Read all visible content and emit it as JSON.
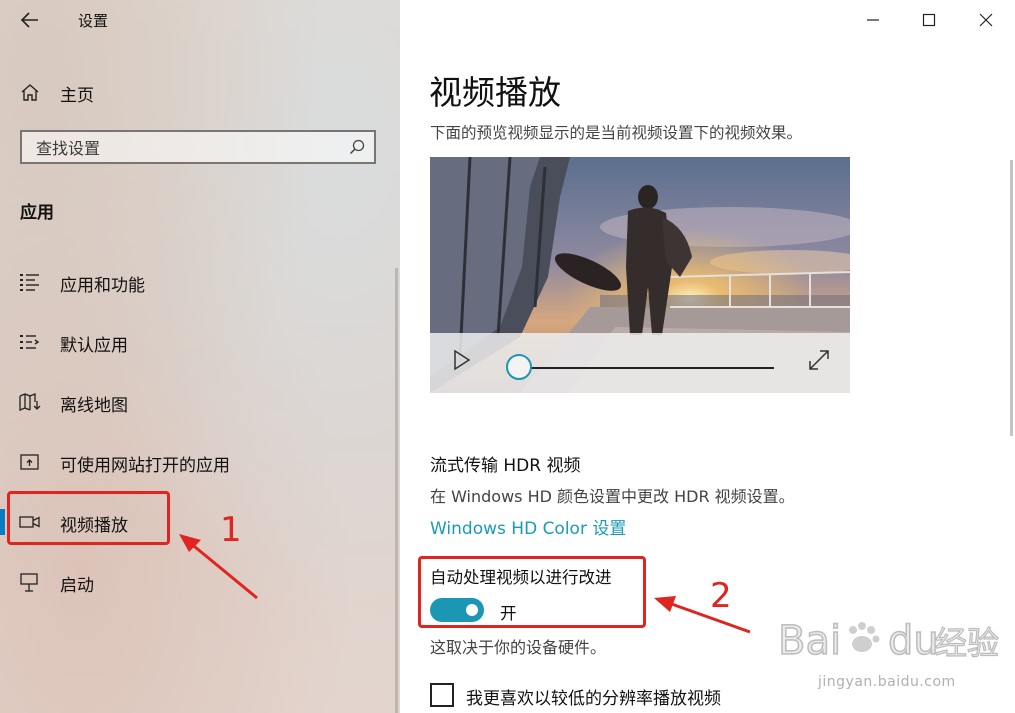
{
  "window": {
    "title": "设置"
  },
  "sidebar": {
    "home_label": "主页",
    "search": {
      "placeholder": "查找设置"
    },
    "section_heading": "应用",
    "items": [
      {
        "label": "应用和功能",
        "icon": "list-icon"
      },
      {
        "label": "默认应用",
        "icon": "default-apps-icon"
      },
      {
        "label": "离线地图",
        "icon": "map-download-icon"
      },
      {
        "label": "可使用网站打开的应用",
        "icon": "open-in-icon"
      },
      {
        "label": "视频播放",
        "icon": "video-camera-icon",
        "selected": true
      },
      {
        "label": "启动",
        "icon": "startup-icon"
      }
    ]
  },
  "main": {
    "page_title": "视频播放",
    "preview_desc": "下面的预览视频显示的是当前视频设置下的视频效果。",
    "video": {
      "progress": 0
    },
    "hdr": {
      "title": "流式传输 HDR 视频",
      "desc": "在 Windows HD 颜色设置中更改 HDR 视频设置。",
      "link": "Windows HD Color 设置"
    },
    "auto_process": {
      "title": "自动处理视频以进行改进",
      "state": "开",
      "on": true,
      "note": "这取决于你的设备硬件。"
    },
    "low_res": {
      "label": "我更喜欢以较低的分辨率播放视频",
      "checked": false
    }
  },
  "annotations": {
    "marker_1": "1",
    "marker_2": "2",
    "color": "#e0241f"
  },
  "watermark": {
    "brand": "Bai du 经验",
    "url": "jingyan.baidu.com"
  },
  "colors": {
    "accent": "#1b96b5",
    "link": "#1a9bb8",
    "selection": "#0a7cc4"
  }
}
